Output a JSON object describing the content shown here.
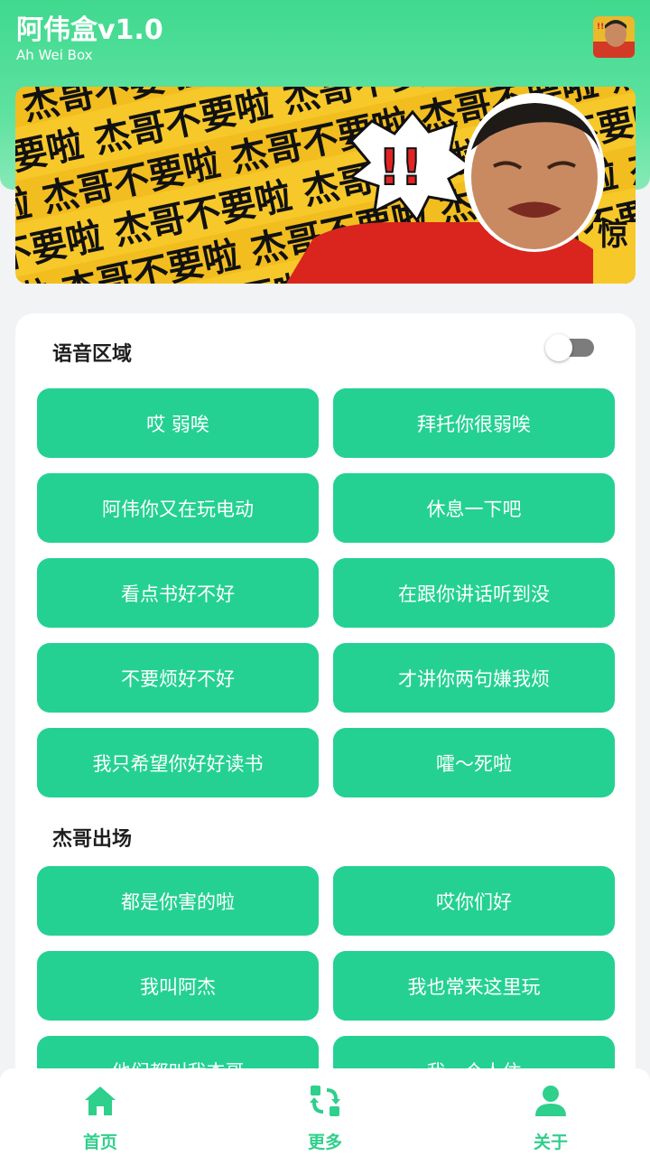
{
  "app": {
    "title": "阿伟盒v1.0",
    "subtitle": "Ah Wei Box"
  },
  "banner": {
    "repeat_text": "杰哥不要啦",
    "exclaim": "!!",
    "side_text": "惊"
  },
  "sections": [
    {
      "title": "语音区域",
      "toggle_on": false,
      "buttons": [
        "哎 弱唉",
        "拜托你很弱唉",
        "阿伟你又在玩电动",
        "休息一下吧",
        "看点书好不好",
        "在跟你讲话听到没",
        "不要烦好不好",
        "才讲你两句嫌我烦",
        "我只希望你好好读书",
        "嚯～死啦"
      ]
    },
    {
      "title": "杰哥出场",
      "buttons": [
        "都是你害的啦",
        "哎你们好",
        "我叫阿杰",
        "我也常来这里玩",
        "他们都叫我杰哥",
        "我一个人住"
      ]
    }
  ],
  "nav": [
    {
      "label": "首页",
      "icon": "home-icon",
      "active": true
    },
    {
      "label": "更多",
      "icon": "refresh-grid-icon",
      "active": false
    },
    {
      "label": "关于",
      "icon": "user-icon",
      "active": false
    }
  ],
  "colors": {
    "accent": "#24d193",
    "header": "#3fd98e",
    "banner_yellow": "#f7c82a"
  }
}
